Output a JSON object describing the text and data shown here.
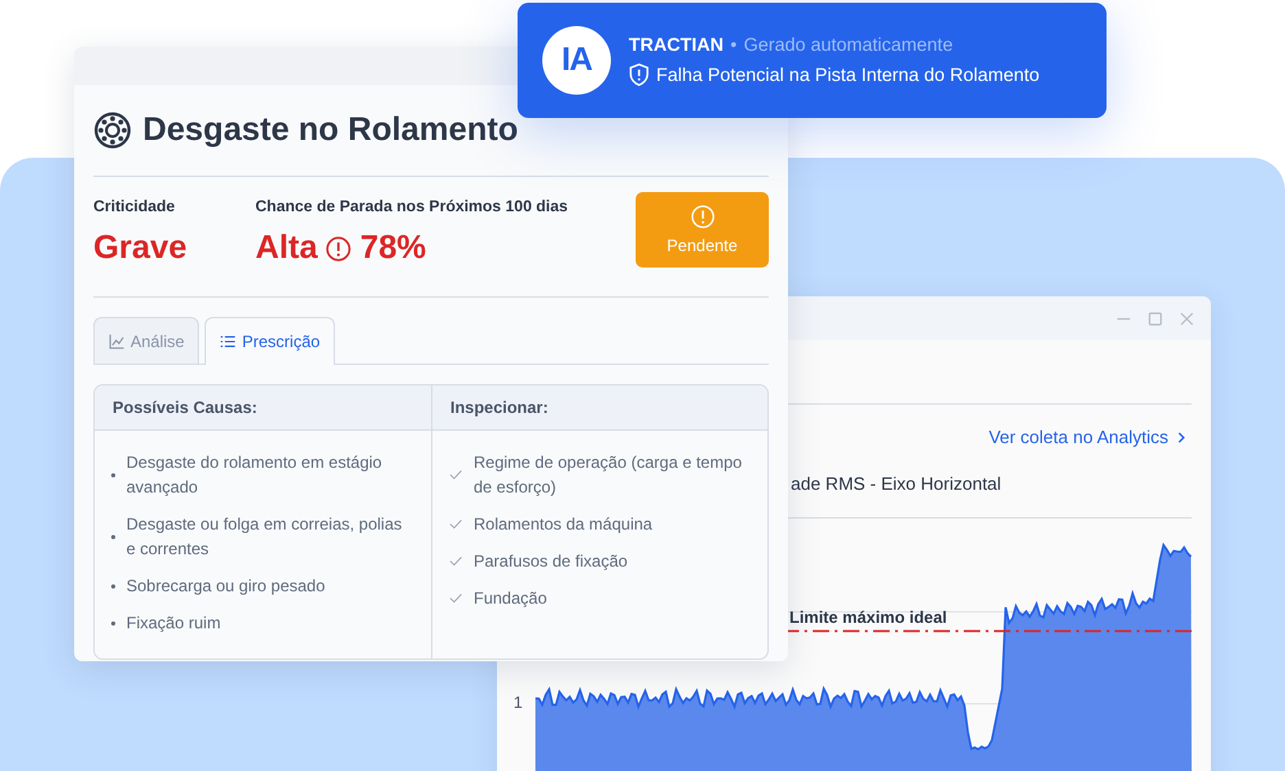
{
  "toast": {
    "logo_text": "IA",
    "brand": "TRACTIAN",
    "separator": "•",
    "subtitle": "Gerado automaticamente",
    "message": "Falha Potencial na Pista Interna do Rolamento"
  },
  "card": {
    "title": "Desgaste no Rolamento",
    "criticality": {
      "label": "Criticidade",
      "value": "Grave"
    },
    "chance": {
      "label": "Chance de Parada nos Próximos 100 dias",
      "value": "Alta",
      "percent": "78%"
    },
    "status_button": "Pendente",
    "tabs": [
      {
        "label": "Análise",
        "selected": false
      },
      {
        "label": "Prescrição",
        "selected": true
      }
    ],
    "causes": {
      "heading": "Possíveis Causas:",
      "items": [
        "Desgaste do rolamento em estágio avançado",
        "Desgaste ou folga em correias, polias e correntes",
        "Sobrecarga ou giro pesado",
        "Fixação ruim"
      ]
    },
    "inspect": {
      "heading": "Inspecionar:",
      "items": [
        "Regime de operação (carga e tempo de esforço)",
        "Rolamentos da máquina",
        "Parafusos de fixação",
        "Fundação"
      ]
    }
  },
  "analytics_window": {
    "link": "Ver coleta no Analytics",
    "subtitle": "ade RMS - Eixo Horizontal",
    "limit_label": "Limite máximo ideal",
    "y_tick": "1"
  }
}
